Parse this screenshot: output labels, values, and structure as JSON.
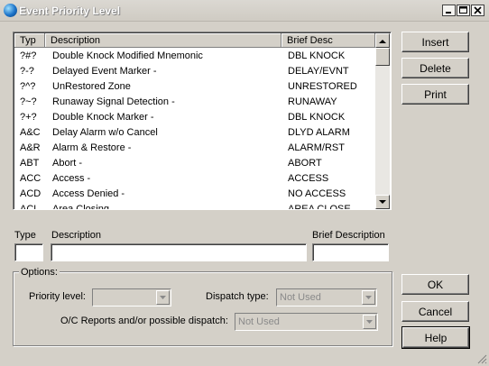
{
  "window": {
    "title": "Event Priority Level"
  },
  "list": {
    "columns": [
      "Typ",
      "Description",
      "Brief Desc"
    ],
    "rows": [
      {
        "typ": "?#?",
        "desc": "Double Knock Modified Mnemonic",
        "brief": "DBL KNOCK"
      },
      {
        "typ": "?-?",
        "desc": "Delayed Event Marker -",
        "brief": "DELAY/EVNT"
      },
      {
        "typ": "?^?",
        "desc": "UnRestored Zone",
        "brief": "UNRESTORED"
      },
      {
        "typ": "?~?",
        "desc": "Runaway Signal Detection -",
        "brief": "RUNAWAY"
      },
      {
        "typ": "?+?",
        "desc": "Double Knock Marker -",
        "brief": "DBL KNOCK"
      },
      {
        "typ": "A&C",
        "desc": "Delay Alarm w/o Cancel",
        "brief": "DLYD ALARM"
      },
      {
        "typ": "A&R",
        "desc": "Alarm & Restore -",
        "brief": "ALARM/RST"
      },
      {
        "typ": "ABT",
        "desc": "Abort -",
        "brief": "ABORT"
      },
      {
        "typ": "ACC",
        "desc": "Access -",
        "brief": "ACCESS"
      },
      {
        "typ": "ACD",
        "desc": "Access Denied -",
        "brief": "NO ACCESS"
      },
      {
        "typ": "ACL",
        "desc": "Area Closing",
        "brief": "AREA CLOSE"
      }
    ]
  },
  "buttons": {
    "insert": "Insert",
    "delete": "Delete",
    "print": "Print",
    "ok": "OK",
    "cancel": "Cancel",
    "help": "Help"
  },
  "fields": {
    "type_label": "Type",
    "type_value": "",
    "description_label": "Description",
    "description_value": "",
    "brief_label": "Brief Description",
    "brief_value": ""
  },
  "options": {
    "legend": "Options:",
    "priority_label": "Priority level:",
    "priority_value": "",
    "dispatch_label": "Dispatch type:",
    "dispatch_value": "Not Used",
    "oc_label": "O/C Reports and/or possible dispatch:",
    "oc_value": "Not Used"
  },
  "icons": {
    "title": "globe-icon",
    "minimize": "minimize-icon",
    "maximize": "maximize-icon",
    "close": "close-icon"
  }
}
